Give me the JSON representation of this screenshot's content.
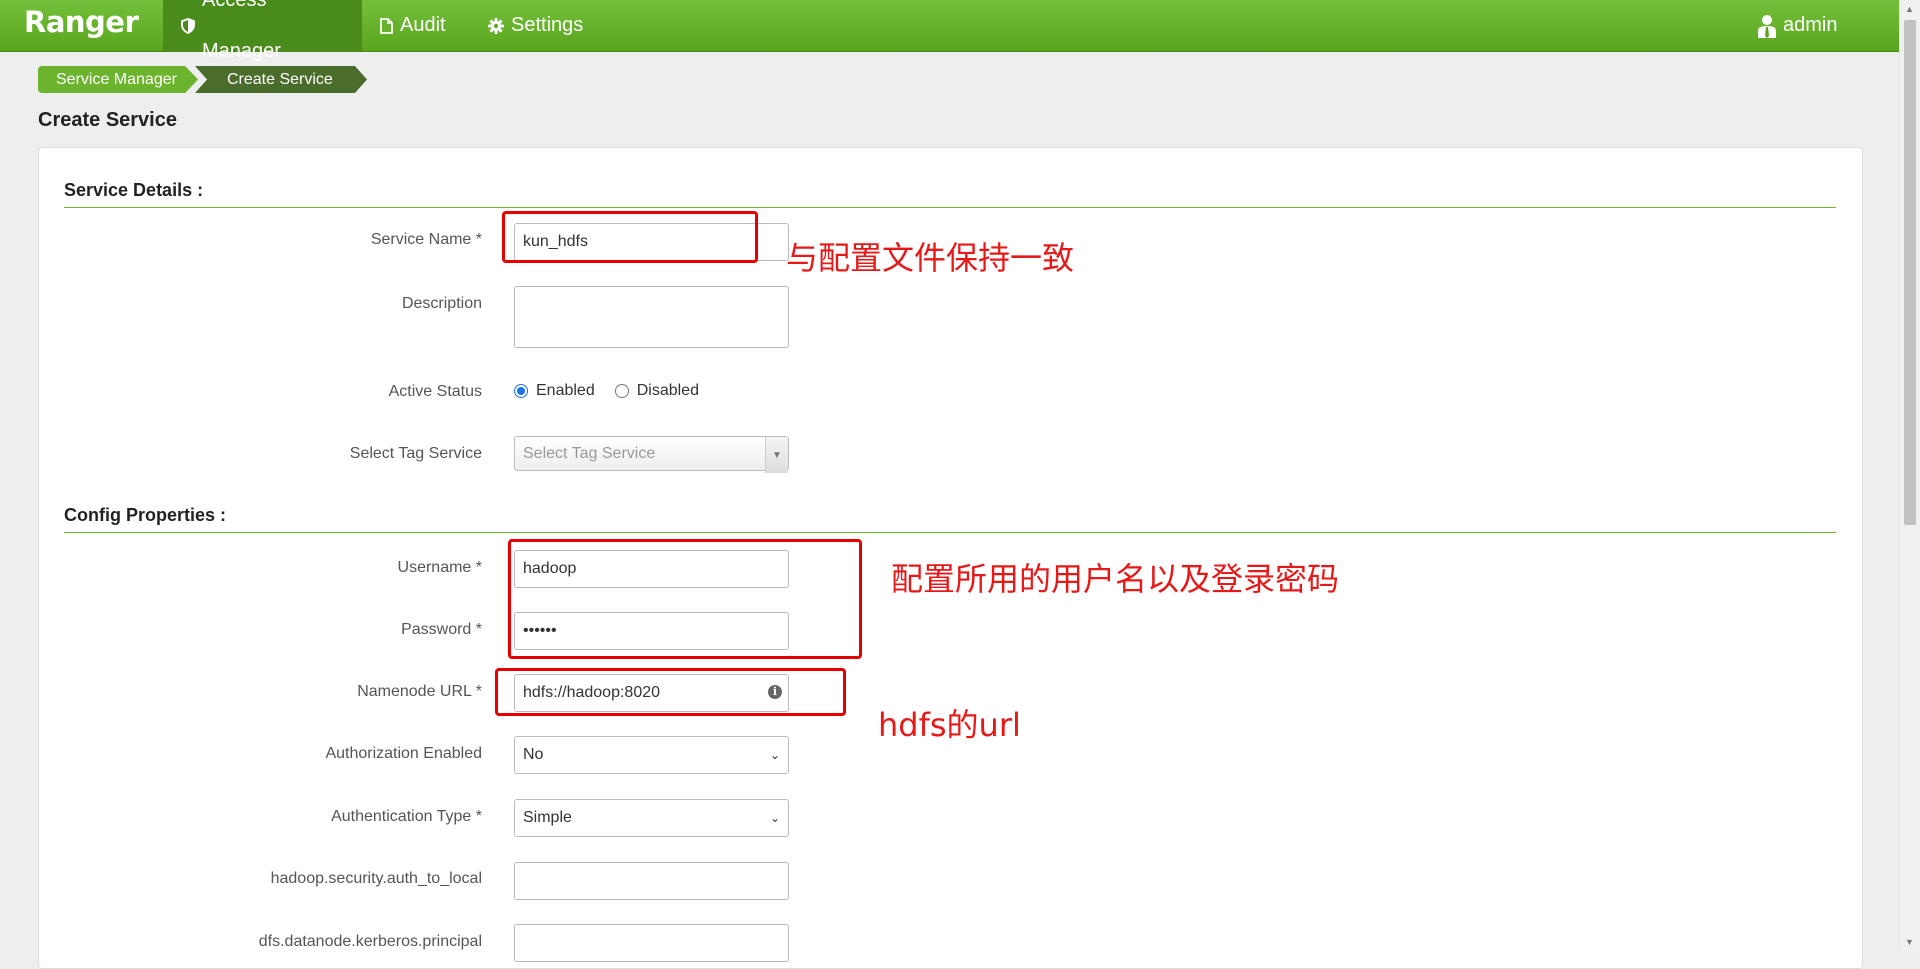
{
  "navbar": {
    "brand": "Ranger",
    "items": [
      {
        "label": "Access Manager",
        "icon": "shield-icon"
      },
      {
        "label": "Audit",
        "icon": "file-icon"
      },
      {
        "label": "Settings",
        "icon": "gear-icon"
      }
    ],
    "user": {
      "label": "admin",
      "icon": "user-icon"
    }
  },
  "breadcrumb": [
    "Service Manager",
    "Create Service"
  ],
  "page_title": "Create Service",
  "service_details": {
    "heading": "Service Details :",
    "service_name": {
      "label": "Service Name *",
      "value": "kun_hdfs"
    },
    "description": {
      "label": "Description",
      "value": ""
    },
    "active_status": {
      "label": "Active Status",
      "options": [
        "Enabled",
        "Disabled"
      ],
      "selected": "Enabled"
    },
    "tag_service": {
      "label": "Select Tag Service",
      "placeholder": "Select Tag Service"
    }
  },
  "config_properties": {
    "heading": "Config Properties :",
    "username": {
      "label": "Username *",
      "value": "hadoop"
    },
    "password": {
      "label": "Password *",
      "value": "••••••"
    },
    "namenode_url": {
      "label": "Namenode URL *",
      "value": "hdfs://hadoop:8020"
    },
    "authorization_enabled": {
      "label": "Authorization Enabled",
      "value": "No"
    },
    "authentication_type": {
      "label": "Authentication Type *",
      "value": "Simple"
    },
    "auth_to_local": {
      "label": "hadoop.security.auth_to_local",
      "value": ""
    },
    "datanode_principal": {
      "label": "dfs.datanode.kerberos.principal",
      "value": ""
    }
  },
  "annotations": {
    "service_name_note": "与配置文件保持一致",
    "credentials_note": "配置所用的用户名以及登录密码",
    "url_note": "hdfs的url"
  },
  "colors": {
    "navbar": "#6cb32e",
    "nav_active": "#4a8c1c",
    "annotation": "#e60000"
  }
}
